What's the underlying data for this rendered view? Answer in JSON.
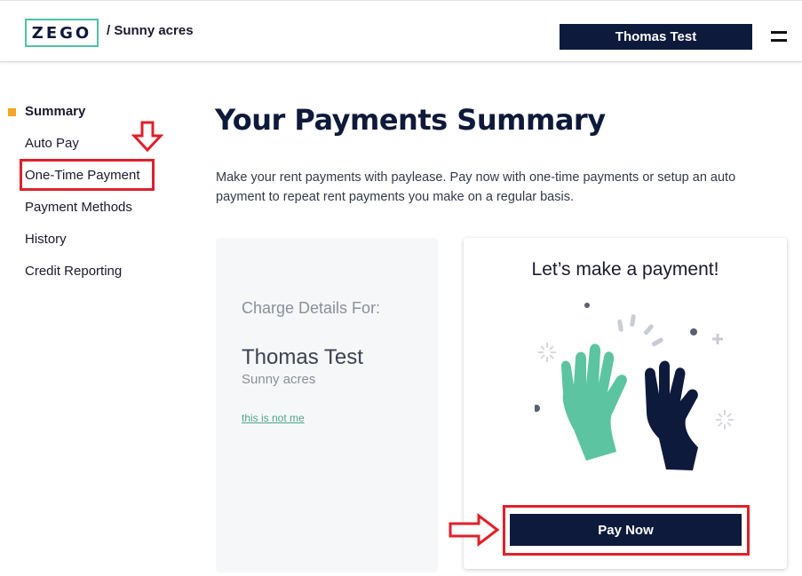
{
  "header": {
    "logo": "ZEGO",
    "breadcrumb": "/ Sunny acres",
    "user_button": "Thomas Test"
  },
  "sidebar": {
    "items": [
      {
        "label": "Summary",
        "active": true
      },
      {
        "label": "Auto Pay"
      },
      {
        "label": "One-Time Payment"
      },
      {
        "label": "Payment Methods"
      },
      {
        "label": "History"
      },
      {
        "label": "Credit Reporting"
      }
    ]
  },
  "main": {
    "title": "Your Payments Summary",
    "intro": "Make your rent payments with paylease. Pay now with one-time payments or setup an auto payment to repeat rent payments you make on a regular basis.",
    "charge_card": {
      "label": "Charge Details For:",
      "name": "Thomas Test",
      "property": "Sunny acres",
      "not_me_link": "this is not me"
    },
    "pay_card": {
      "title": "Let’s make a payment!",
      "button": "Pay Now"
    }
  },
  "colors": {
    "navy": "#0e1a3c",
    "accent_teal": "#4fc3a1",
    "active_marker": "#f5a623",
    "annotation_red": "#e0202a"
  }
}
